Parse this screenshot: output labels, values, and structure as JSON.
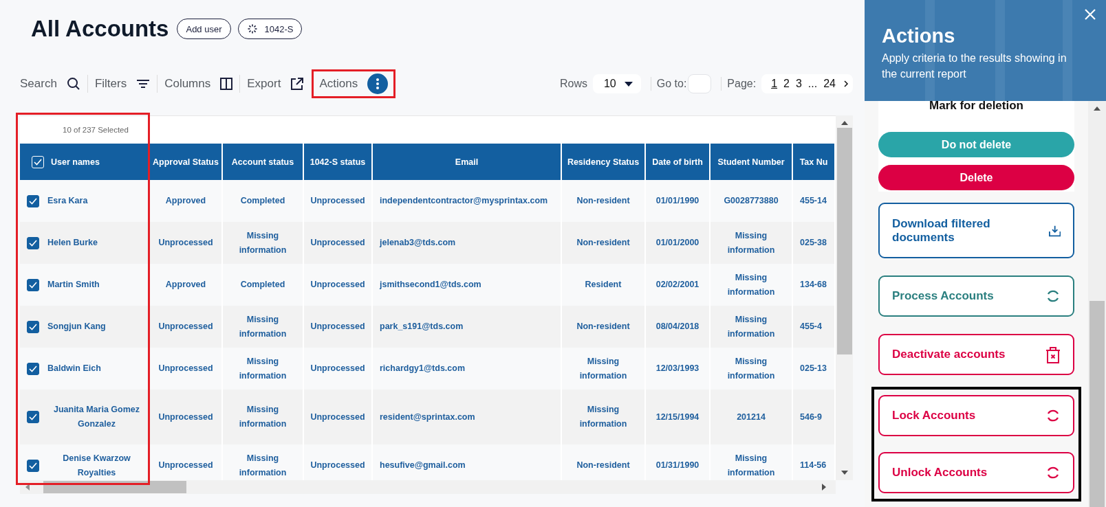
{
  "page": {
    "title": "All Accounts",
    "header_buttons": [
      {
        "label": "Add user",
        "kind": "plain"
      },
      {
        "label": "1042-S",
        "kind": "spinner"
      }
    ]
  },
  "toolbar": {
    "tools": [
      {
        "label": "Search",
        "kind": "search"
      },
      {
        "label": "Filters",
        "kind": "filter"
      },
      {
        "label": "Columns",
        "kind": "columns"
      },
      {
        "label": "Export",
        "kind": "export"
      }
    ],
    "actions": {
      "label": "Actions",
      "highlighted": true
    },
    "rows": {
      "label": "Rows",
      "value": "10"
    },
    "goto": {
      "label": "Go to:"
    },
    "pagination": {
      "label": "Page:",
      "pages": [
        {
          "label": "1",
          "selected": true
        },
        {
          "label": "2",
          "selected": false
        },
        {
          "label": "3",
          "selected": false
        },
        {
          "label": "...",
          "selected": false
        },
        {
          "label": "24",
          "selected": false
        }
      ]
    }
  },
  "table": {
    "selection_text": "10 of 237 Selected",
    "all_checked": true,
    "first_column_highlighted": true,
    "columns": [
      "User names",
      "Approval Status",
      "Account status",
      "1042-S status",
      "Email",
      "Residency Status",
      "Date of birth",
      "Student Number",
      "Tax Nu"
    ],
    "rows": [
      {
        "checked": true,
        "cells": [
          "Esra Kara",
          "Approved",
          "Completed",
          "Unprocessed",
          "independentcontractor@mysprintax.com",
          "Non-resident",
          "01/01/1990",
          "G0028773880",
          "455-14"
        ]
      },
      {
        "checked": true,
        "cells": [
          "Helen Burke",
          "Unprocessed",
          "Missing information",
          "Unprocessed",
          "jelenab3@tds.com",
          "Non-resident",
          "01/01/2000",
          "Missing information",
          "025-38"
        ]
      },
      {
        "checked": true,
        "cells": [
          "Martin Smith",
          "Approved",
          "Completed",
          "Unprocessed",
          "jsmithsecond1@tds.com",
          "Resident",
          "02/02/2001",
          "Missing information",
          "134-68"
        ]
      },
      {
        "checked": true,
        "cells": [
          "Songjun Kang",
          "Unprocessed",
          "Missing information",
          "Unprocessed",
          "park_s191@tds.com",
          "Non-resident",
          "08/04/2018",
          "Missing information",
          "455-4"
        ]
      },
      {
        "checked": true,
        "cells": [
          "Baldwin Eich",
          "Unprocessed",
          "Missing information",
          "Unprocessed",
          "richardgy1@tds.com",
          "Missing information",
          "12/03/1993",
          "Missing information",
          "025-13"
        ]
      },
      {
        "checked": true,
        "cells": [
          "Juanita Maria Gomez Gonzalez",
          "Unprocessed",
          "Missing information",
          "Unprocessed",
          "resident@sprintax.com",
          "Missing information",
          "12/15/1994",
          "201214",
          "546-9"
        ]
      },
      {
        "checked": true,
        "cells": [
          "Denise Kwarzow Royalties",
          "Unprocessed",
          "Missing information",
          "Unprocessed",
          "hesufive@gmail.com",
          "Non-resident",
          "01/31/1990",
          "Missing information",
          "114-56"
        ]
      }
    ]
  },
  "panel": {
    "title": "Actions",
    "subtitle": "Apply criteria to the results showing in the current report",
    "deletion": {
      "title": "Mark for deletion",
      "buttons": [
        {
          "label": "Do not delete",
          "color": "#2aa5a8"
        },
        {
          "label": "Delete",
          "color": "#dc0044"
        }
      ]
    },
    "actions": [
      {
        "label": "Download filtered documents",
        "kind": "download",
        "color": "#135fa0"
      },
      {
        "label": "Process Accounts",
        "kind": "spinner",
        "color": "#2a7f7f"
      },
      {
        "label": "Deactivate accounts",
        "kind": "trash",
        "color": "#dc0044"
      }
    ],
    "highlighted_actions": [
      {
        "label": "Lock Accounts",
        "kind": "spinner",
        "color": "#dc0044"
      },
      {
        "label": "Unlock Accounts",
        "kind": "spinner",
        "color": "#dc0044"
      }
    ]
  }
}
